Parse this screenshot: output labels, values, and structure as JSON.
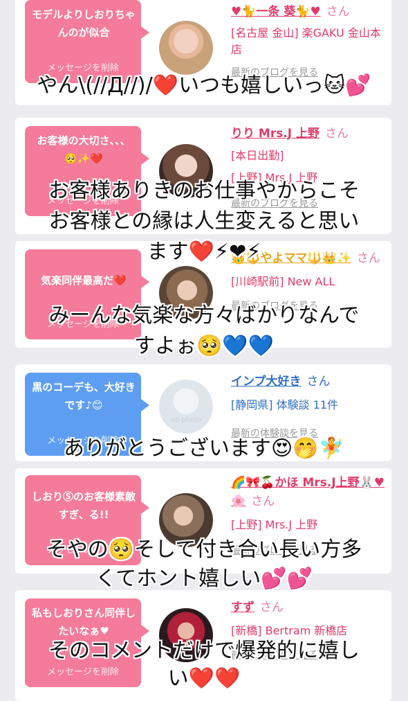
{
  "cards": [
    {
      "bubble": "モデルよりしおりちゃんのが似合",
      "delete_label": "メッセージを削除",
      "name": "♥🐈一条 葵🐈♥",
      "san": "さん",
      "shop": "[名古屋 金山] 楽GAKU 金山本店",
      "blog": "最新のブログを見る"
    },
    {
      "bubble": "お客様の大切さ、、、🥺✨❤️",
      "delete_label": "メッセージを削除",
      "name": "りり Mrs.J 上野",
      "san": "さん",
      "shop": "[本日出勤]",
      "shop2": "[上野] Mrs.J 上野",
      "blog": "最新のブログを見る"
    },
    {
      "bubble": "気楽同伴最高だ❤️",
      "delete_label": "メッセージを削除",
      "name": "👑🔱やよママ🔱👑✨",
      "san": "さん",
      "shop": "[川崎駅前] New ALL",
      "blog": "最新のブログを見る"
    },
    {
      "bubble": "黒のコーデも、大好きです♪😊",
      "delete_label": "メッセージを削除",
      "name": "インプ大好き",
      "san": "さん",
      "shop": "[静岡県] 体験談 11件",
      "blog": "最新の体験談を見る",
      "avatar_text": "no photo"
    },
    {
      "bubble": "しおりⓈのお客様素敵すぎ、る!!",
      "delete_label": "メッセージを削除",
      "name": "🌈🎀🍒かほ Mrs.J上野🐰♥🌸",
      "san": "さん",
      "shop": "[上野] Mrs.J 上野",
      "blog": "最新のブログを見る"
    },
    {
      "bubble": "私もしおりさん同伴したいなぁ♥",
      "delete_label": "メッセージを削除",
      "name": "すず",
      "san": "さん",
      "shop": "[新橋] Bertram 新橋店",
      "blog": "最新のブログを見る"
    }
  ],
  "captions": [
    "やん\\(//Д//)/❤️いつも嬉しいっ🐱💕",
    "お客様ありきのお仕事やからこそ",
    "お客様との縁は人生変えると思い",
    "ます❤️⚡❤⚡",
    "みーんな気楽な方々ばかりなんで",
    "すよぉ🥺💙💙",
    "ありがとうございます😍🤭🧚",
    "そやの🥺そして付き合い長い方多",
    "くてホント嬉しい💕💕",
    "そのコメントだけで爆発的に嬉し",
    "い❤️❤️"
  ],
  "colors": {
    "pink_bubble": "#f47b9a",
    "blue_bubble": "#5e9ef2",
    "name_pink": "#e03b6a",
    "name_blue": "#2f6fc5"
  }
}
